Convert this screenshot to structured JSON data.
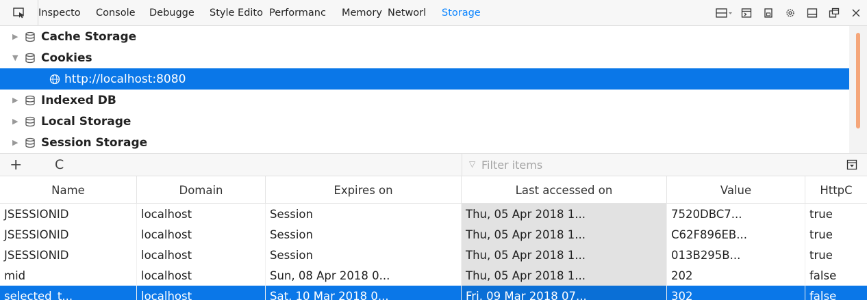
{
  "toolbar": {
    "tabs": [
      {
        "label": "Inspecto"
      },
      {
        "label": "Console"
      },
      {
        "label": "Debugge"
      },
      {
        "label": "Style Edito"
      },
      {
        "label": "Performanc"
      },
      {
        "label": "Memory"
      },
      {
        "label": "Networl"
      },
      {
        "label": "Storage"
      }
    ],
    "selected_tab": "Storage",
    "icons": [
      "picker-icon",
      "responsive-icon",
      "split-console-icon",
      "screenshot-icon",
      "settings-icon",
      "dock-icon",
      "undock-icon",
      "close-icon"
    ]
  },
  "tree": {
    "cache_storage": "Cache Storage",
    "cookies": "Cookies",
    "cookie_host": "http://localhost:8080",
    "indexed_db": "Indexed DB",
    "local_storage": "Local Storage",
    "session_storage": "Session Storage"
  },
  "subbar": {
    "add_label": "+",
    "refresh_label": "C",
    "filter_placeholder": "Filter items"
  },
  "table": {
    "columns": [
      "Name",
      "Domain",
      "Expires on",
      "Last accessed on",
      "Value",
      "HttpC"
    ],
    "rows": [
      {
        "name": "JSESSIONID",
        "domain": "localhost",
        "expires": "Session",
        "last": "Thu, 05 Apr 2018 1...",
        "value": "7520DBC7...",
        "http": "true"
      },
      {
        "name": "JSESSIONID",
        "domain": "localhost",
        "expires": "Session",
        "last": "Thu, 05 Apr 2018 1...",
        "value": "C62F896EB...",
        "http": "true"
      },
      {
        "name": "JSESSIONID",
        "domain": "localhost",
        "expires": "Session",
        "last": "Thu, 05 Apr 2018 1...",
        "value": "013B295B...",
        "http": "true"
      },
      {
        "name": "mid",
        "domain": "localhost",
        "expires": "Sun, 08 Apr 2018 0...",
        "last": "Thu, 05 Apr 2018 1...",
        "value": "202",
        "http": "false"
      },
      {
        "name": "selected_t...",
        "domain": "localhost",
        "expires": "Sat, 10 Mar 2018 0...",
        "last": "Fri, 09 Mar 2018 07...",
        "value": "302",
        "http": "false"
      }
    ],
    "selected_row": 4
  },
  "colors": {
    "accent": "#0a84ff",
    "selection": "#0a77e8",
    "scroll_thumb": "#f5a67a"
  }
}
